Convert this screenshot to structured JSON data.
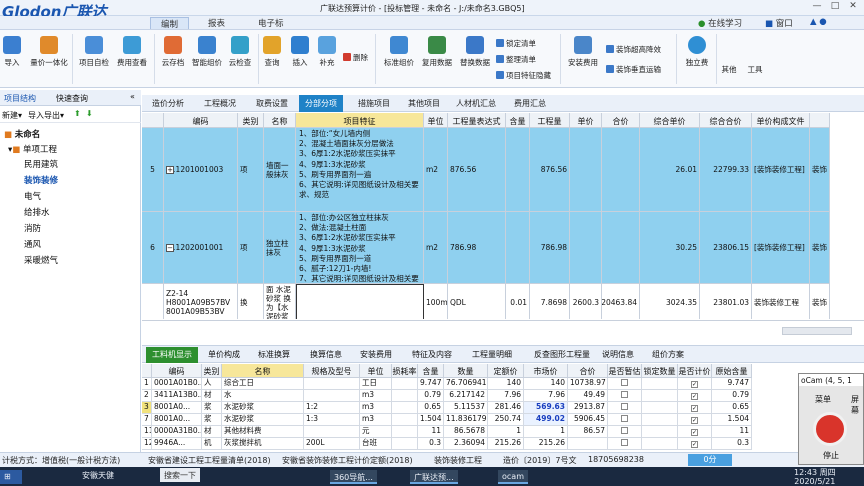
{
  "app": {
    "logo": "Glodon广联达",
    "title": "广联达预算计价 - [投标管理 - 未命名 - J:/未命名3.GBQ5]",
    "menu_tabs": [
      "编制",
      "报表",
      "电子标"
    ],
    "active_menu": "编制",
    "online_learning": "在线学习",
    "window_menu": "窗口"
  },
  "colors": {
    "row_highlight": "#8fd0ef",
    "feature_header": "#f7e79a",
    "tab_active": "#1f82c7",
    "bottom_tab_active": "#2d8f2f",
    "logo": "#1a56b0"
  },
  "ribbon": {
    "big_buttons": [
      "导入",
      "量价一体化",
      "项目自检",
      "费用查看",
      "云存档",
      "智能组价",
      "云检查",
      "查询",
      "插入",
      "补充",
      "标准组价",
      "复用数据",
      "替换数据",
      "安装费用",
      "独立费",
      "其他",
      "工具"
    ],
    "delete": "删除",
    "small_buttons": [
      "锁定清单",
      "整理清单",
      "项目特征隐藏",
      "装饰超高降效",
      "装饰垂直运输"
    ]
  },
  "left_panel": {
    "tabs": [
      "项目结构",
      "快速查询"
    ],
    "tools": [
      "新建",
      "导入导出"
    ],
    "root": "未命名",
    "group": "单项工程",
    "items": [
      "民用建筑",
      "装饰装修",
      "电气",
      "给排水",
      "消防",
      "通风",
      "采暖燃气"
    ],
    "selected": "装饰装修"
  },
  "main_tabs": [
    "造价分析",
    "工程概况",
    "取费设置",
    "分部分项",
    "措施项目",
    "其他项目",
    "人材机汇总",
    "费用汇总"
  ],
  "active_main_tab": "分部分项",
  "upper_grid": {
    "columns": [
      "编码",
      "类别",
      "名称",
      "项目特征",
      "单位",
      "工程量表达式",
      "含量",
      "工程量",
      "单价",
      "合价",
      "综合单价",
      "综合合价",
      "单价构成文件",
      ""
    ],
    "rows": [
      {
        "no": "5",
        "code": "011201001003",
        "type": "项",
        "name": "墙面一般抹灰",
        "feature": "1、部位:“女儿墙内侧\n2、混凝土墙面抹灰分层做法\n3、6厚1:2水泥砂浆压实抹平\n4、9厚1:3水泥砂浆\n5、刷专用界面剂一遍\n6、其它说明:详见图纸设计及相关要求、规范",
        "unit": "m2",
        "expr": "876.56",
        "content": "",
        "qty": "876.56",
        "price": "",
        "total": "",
        "unit_total": "26.01",
        "sum_total": "22799.33",
        "file": "[装饰装修工程]",
        "extra": "装饰"
      },
      {
        "no": "6",
        "code": "011202001001",
        "type": "项",
        "name": "独立柱抹灰",
        "feature": "1、部位:办公区独立柱抹灰\n2、做法:混凝土柱面\n3、6厚1:2水泥砂浆压实抹平\n4、9厚1:3水泥砂浆\n5、刷专用界面剂一道\n6、腻子:12刀1-内墙!\n7、其它说明:详见图纸设计及相关要求、规范",
        "unit": "m2",
        "expr": "786.98",
        "content": "",
        "qty": "786.98",
        "price": "",
        "total": "",
        "unit_total": "30.25",
        "sum_total": "23806.15",
        "file": "[装饰装修工程]",
        "extra": "装饰"
      },
      {
        "no": "",
        "code": "Z2-14\nH8001A09B57BV\n8001A09B53BV",
        "type": "换",
        "name": "柱、梁面 水泥砂浆 换为【水泥砂浆 1:2】",
        "feature": "",
        "unit": "100m2",
        "expr": "QDL",
        "content": "0.01",
        "qty": "7.8698",
        "price": "2600.3",
        "total": "20463.84",
        "unit_total": "3024.35",
        "sum_total": "23801.03",
        "file": "装饰装修工程",
        "extra": "装饰"
      }
    ]
  },
  "bottom_tabs": [
    "工料机显示",
    "单价构成",
    "标准换算",
    "换算信息",
    "安装费用",
    "特征及内容",
    "工程量明细",
    "反查图形工程量",
    "说明信息",
    "组价方案"
  ],
  "active_bottom_tab": "工料机显示",
  "bottom_grid": {
    "columns": [
      "编码",
      "类别",
      "名称",
      "规格及型号",
      "单位",
      "损耗率",
      "含量",
      "数量",
      "定额价",
      "市场价",
      "合价",
      "是否暂估",
      "锁定数量",
      "是否计价",
      "原始含量"
    ],
    "rows": [
      {
        "no": "1",
        "code": "0001A01B0...",
        "type": "人",
        "name": "综合工日",
        "spec": "",
        "unit": "工日",
        "loss": "",
        "content": "9.747",
        "count": "76.706941",
        "fixed": "140",
        "market": "140",
        "total": "10738.97",
        "market_hl": false,
        "priced": true,
        "orig": "9.747"
      },
      {
        "no": "2",
        "code": "3411A13B0...",
        "type": "材",
        "name": "水",
        "spec": "",
        "unit": "m3",
        "loss": "",
        "content": "0.79",
        "count": "6.217142",
        "fixed": "7.96",
        "market": "7.96",
        "total": "49.49",
        "market_hl": false,
        "priced": true,
        "orig": "0.79"
      },
      {
        "no": "3",
        "code": "8001A0...",
        "type": "浆",
        "name": "水泥砂浆",
        "spec": "1:2",
        "unit": "m3",
        "loss": "",
        "content": "0.65",
        "count": "5.11537",
        "fixed": "281.46",
        "market": "569.63",
        "total": "2913.87",
        "market_hl": true,
        "priced": true,
        "orig": "0.65"
      },
      {
        "no": "7",
        "code": "8001A0...",
        "type": "浆",
        "name": "水泥砂浆",
        "spec": "1:3",
        "unit": "m3",
        "loss": "",
        "content": "1.504",
        "count": "11.836179",
        "fixed": "250.74",
        "market": "499.02",
        "total": "5906.45",
        "market_hl": true,
        "priced": true,
        "orig": "1.504"
      },
      {
        "no": "11",
        "code": "0000A31B0...",
        "type": "材",
        "name": "其他材料费",
        "spec": "",
        "unit": "元",
        "loss": "",
        "content": "11",
        "count": "86.5678",
        "fixed": "1",
        "market": "1",
        "total": "86.57",
        "market_hl": false,
        "priced": true,
        "orig": "11"
      },
      {
        "no": "12",
        "code": "9946A...",
        "type": "机",
        "name": "灰浆搅拌机",
        "spec": "200L",
        "unit": "台班",
        "loss": "",
        "content": "0.3",
        "count": "2.36094",
        "fixed": "215.26",
        "market": "215.26",
        "total": "",
        "market_hl": false,
        "priced": true,
        "orig": "0.3"
      }
    ]
  },
  "status": {
    "tax": "计税方式：增值税(一般计税方法)",
    "list": "安徽省建设工程工程量清单(2018)",
    "quota": "安徽省装饰装修工程计价定额(2018)",
    "major": "装饰装修工程",
    "price_doc": "造价〔2019〕7号文",
    "phone": "18705698238",
    "score": "0分"
  },
  "taskbar": {
    "items": [
      "安徽天健",
      "搜索一下",
      "360导航...",
      "广联达预...",
      "ocam"
    ],
    "time": "12:43 周四",
    "date": "2020/5/21"
  },
  "ocam": {
    "title": "oCam (4, 5, 1",
    "menu": "菜单",
    "screen": "屏幕",
    "stop": "停止"
  }
}
